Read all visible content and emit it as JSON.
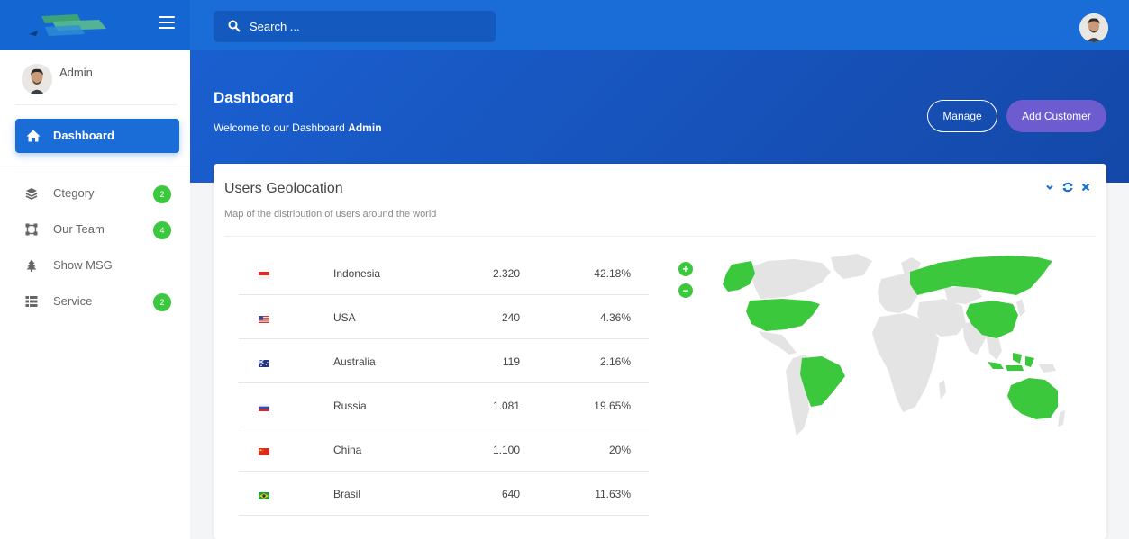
{
  "topbar": {
    "search_placeholder": "Search ...",
    "menu_icon": "hamburger-icon",
    "search_icon": "search-icon"
  },
  "sidebar": {
    "user_name": "Admin",
    "active_item": {
      "label": "Dashboard",
      "icon": "home-icon"
    },
    "items": [
      {
        "label": "Ctegory",
        "icon": "layers-icon",
        "badge": "2"
      },
      {
        "label": "Our Team",
        "icon": "vector-square-icon",
        "badge": "4"
      },
      {
        "label": "Show MSG",
        "icon": "tree-icon",
        "badge": ""
      },
      {
        "label": "Service",
        "icon": "list-icon",
        "badge": "2"
      }
    ]
  },
  "header": {
    "title": "Dashboard",
    "welcome_prefix": "Welcome to our Dashboard ",
    "welcome_user": "Admin",
    "manage_label": "Manage",
    "add_label": "Add Customer"
  },
  "card": {
    "title": "Users Geolocation",
    "subtitle": "Map of the distribution of users around the world",
    "rows": [
      {
        "country": "Indonesia",
        "users": "2.320",
        "percent": "42.18%",
        "flag": "flag-indonesia"
      },
      {
        "country": "USA",
        "users": "240",
        "percent": "4.36%",
        "flag": "flag-usa"
      },
      {
        "country": "Australia",
        "users": "119",
        "percent": "2.16%",
        "flag": "flag-australia"
      },
      {
        "country": "Russia",
        "users": "1.081",
        "percent": "19.65%",
        "flag": "flag-russia"
      },
      {
        "country": "China",
        "users": "1.100",
        "percent": "20%",
        "flag": "flag-china"
      },
      {
        "country": "Brasil",
        "users": "640",
        "percent": "11.63%",
        "flag": "flag-brasil"
      }
    ],
    "zoom_in": "+",
    "zoom_out": "−"
  },
  "colors": {
    "primary": "#1a6cd6",
    "accent_purple": "#6d5bd0",
    "highlight_green": "#3cc83c",
    "map_gray": "#e4e4e4"
  }
}
